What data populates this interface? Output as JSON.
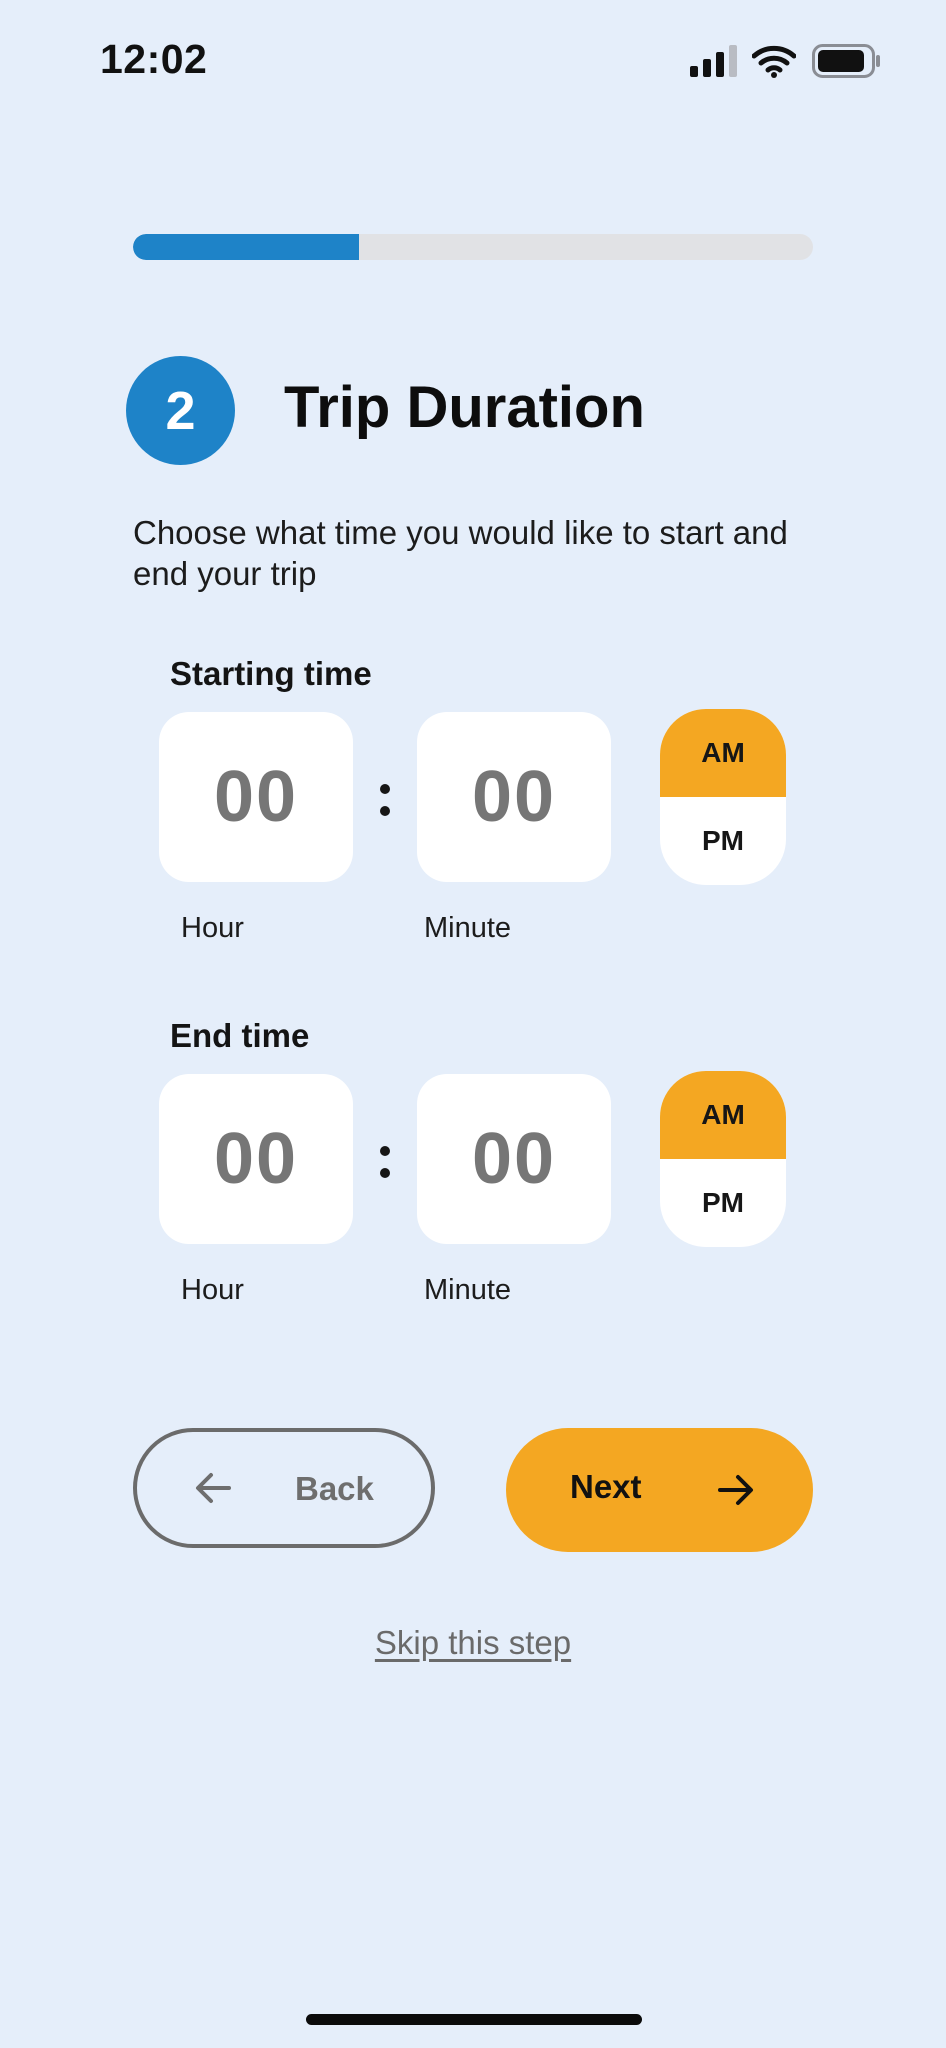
{
  "status_bar": {
    "time": "12:02"
  },
  "progress": {
    "value": 0.333
  },
  "step": {
    "number": "2",
    "title": "Trip Duration",
    "description": "Choose what time you would like to start and end your trip"
  },
  "starting_time": {
    "label": "Starting time",
    "hour": "00",
    "minute": "00",
    "hour_label": "Hour",
    "minute_label": "Minute",
    "am": "AM",
    "pm": "PM",
    "selected_period": "AM"
  },
  "end_time": {
    "label": "End time",
    "hour": "00",
    "minute": "00",
    "hour_label": "Hour",
    "minute_label": "Minute",
    "am": "AM",
    "pm": "PM",
    "selected_period": "AM"
  },
  "actions": {
    "back_label": "Back",
    "next_label": "Next",
    "skip_label": "Skip this step"
  },
  "colors": {
    "background": "#E5EEFA",
    "primary_blue": "#1E83C8",
    "accent_orange": "#F4A722",
    "track_gray": "#E1E2E5"
  },
  "icons": {
    "signal": "signal-icon",
    "wifi": "wifi-icon",
    "battery": "battery-icon",
    "back_arrow": "arrow-left-icon",
    "next_arrow": "arrow-right-icon"
  }
}
